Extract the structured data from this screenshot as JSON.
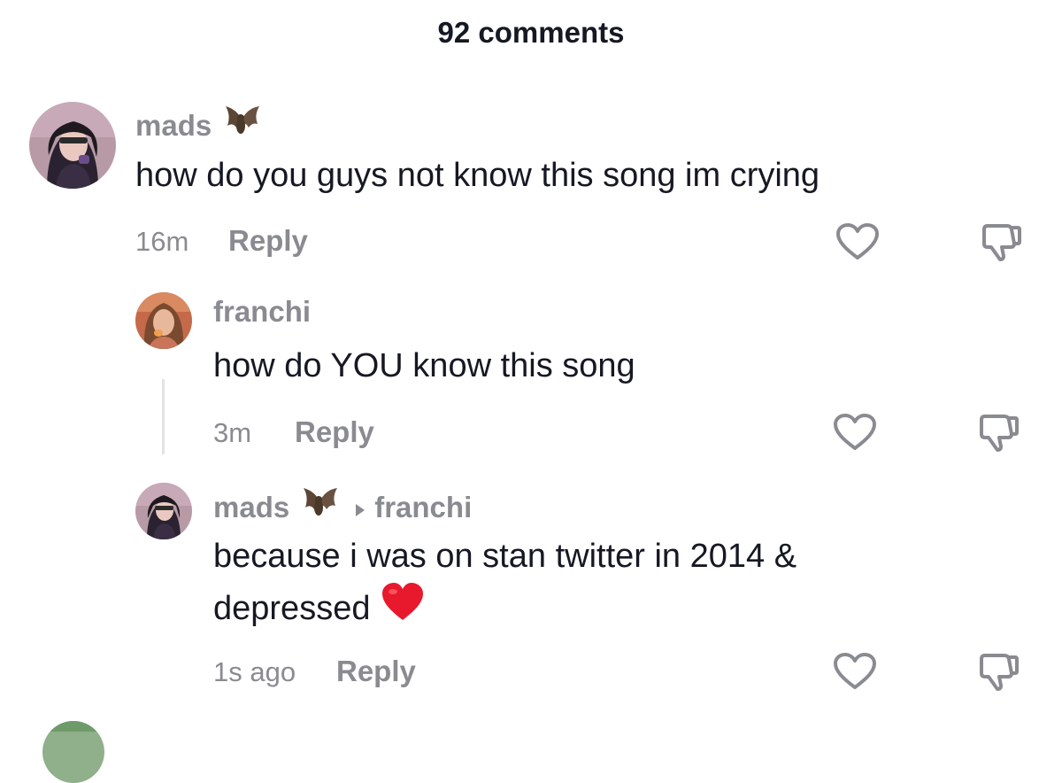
{
  "header": {
    "title": "92 comments"
  },
  "comments": [
    {
      "username": "mads",
      "text": "how do you guys not know this song im crying",
      "time": "16m",
      "reply_label": "Reply"
    },
    {
      "username": "franchi",
      "text": "how do YOU know this song",
      "time": "3m",
      "reply_label": "Reply"
    },
    {
      "username": "mads",
      "reply_to": "franchi",
      "text_line1": "because i was on stan twitter in 2014 &",
      "text_line2": "depressed",
      "time": "1s ago",
      "reply_label": "Reply"
    }
  ],
  "colors": {
    "text_primary": "#161823",
    "text_secondary": "#8a8b91",
    "heart_emoji": "#e8192c"
  },
  "icons": [
    "bat-emoji",
    "heart-outline-icon",
    "thumbs-down-icon",
    "play-arrow-icon",
    "red-heart-emoji"
  ]
}
